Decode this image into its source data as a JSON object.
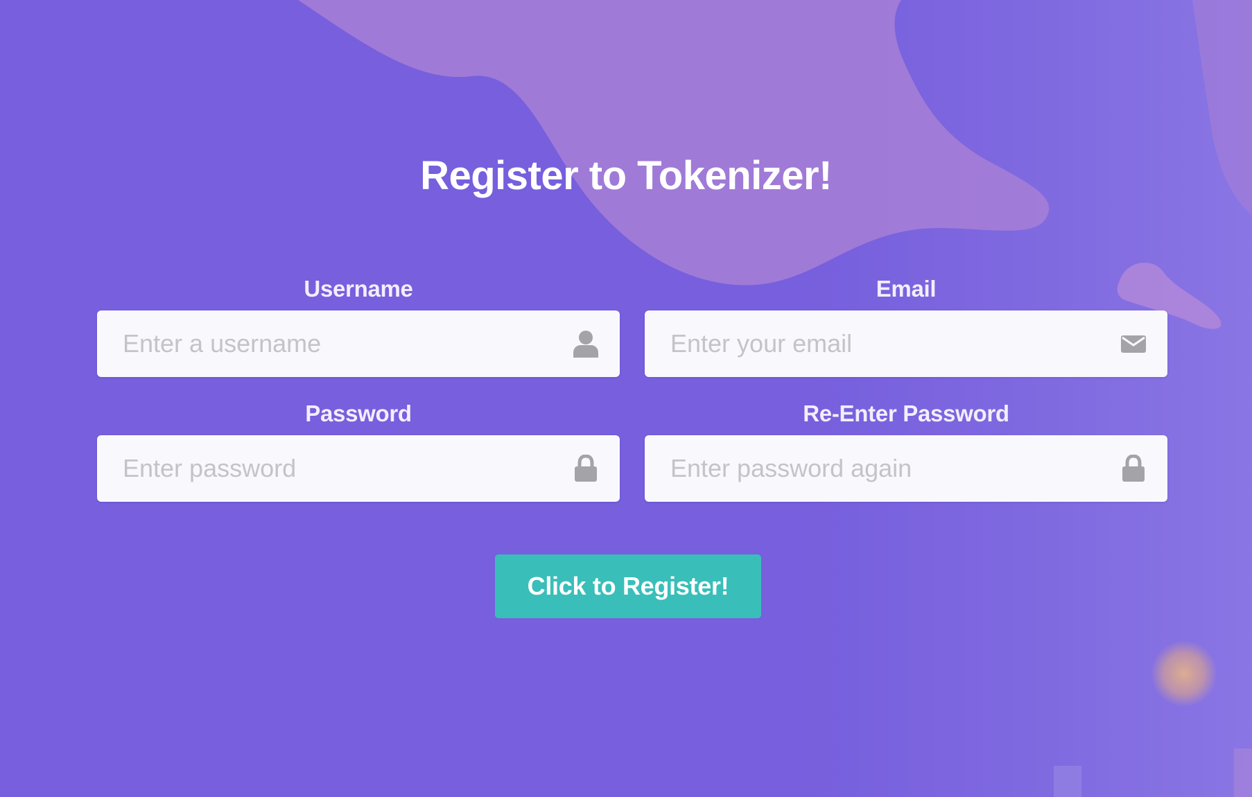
{
  "page": {
    "title": "Register to Tokenizer!"
  },
  "form": {
    "fields": [
      {
        "label": "Username",
        "placeholder": "Enter a username",
        "icon": "user-icon"
      },
      {
        "label": "Email",
        "placeholder": "Enter your email",
        "icon": "envelope-icon"
      },
      {
        "label": "Password",
        "placeholder": "Enter password",
        "icon": "lock-icon"
      },
      {
        "label": "Re-Enter Password",
        "placeholder": "Enter password again",
        "icon": "lock-icon"
      }
    ],
    "submit_label": "Click to Register!"
  },
  "colors": {
    "background": "#775fdd",
    "blob": "#a77fd6",
    "field_background": "#f9f9fd",
    "placeholder": "#c3c3c8",
    "icon": "#a3a3a8",
    "button": "#3abeb9",
    "text": "#ffffff"
  }
}
